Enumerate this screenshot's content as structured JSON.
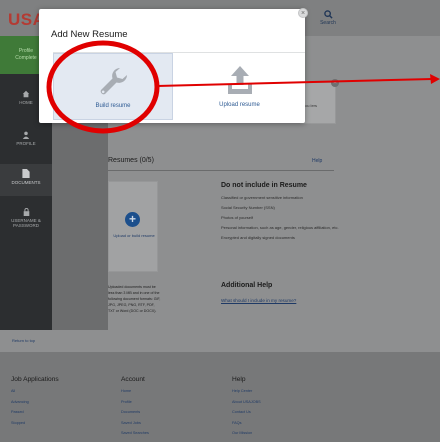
{
  "header": {
    "logo": "USAJ",
    "search_label": "Search"
  },
  "nav": {
    "profile_complete_line1": "Profile",
    "profile_complete_line2": "Complete",
    "home": "HOME",
    "profile": "PROFILE",
    "documents": "DOCUMENTS",
    "passwords_line1": "USERNAME &",
    "passwords_line2": "PASSWORD"
  },
  "partial_card_text": "ocu lers",
  "resumes": {
    "title": "Resumes (0/5)",
    "help": "Help",
    "upload_card_label": "Upload or build resume",
    "upload_note": "Uploaded documents must be less than 3 MB and in one of the following document formats: GIF, JPG, JPEG, PNG, RTF, PDF, TXT or Word (DOC or DOCX)."
  },
  "do_not_include": {
    "title": "Do not include in Resume",
    "items": [
      "Classified or government sensitive information",
      "Social Security Number (SSN)",
      "Photos of yourself",
      "Personal information, such as age, gender, religious affiliation, etc.",
      "Encrypted and digitally signed documents"
    ]
  },
  "additional_help": {
    "title": "Additional Help",
    "link": "What should I include in my resume?"
  },
  "return_to_top": "Return to top",
  "footer": {
    "col1": {
      "title": "Job Applications",
      "links": [
        "All",
        "Advancing",
        "Passed",
        "Stopped"
      ]
    },
    "col2": {
      "title": "Account",
      "links": [
        "Home",
        "Profile",
        "Documents",
        "Saved Jobs",
        "Saved Searches"
      ]
    },
    "col3": {
      "title": "Help",
      "links": [
        "Help Center",
        "About USAJOBS",
        "Contact Us",
        "FAQs",
        "Our Mission"
      ]
    }
  },
  "modal": {
    "title": "Add New Resume",
    "close": "×",
    "build_label": "Build resume",
    "upload_label": "Upload resume"
  },
  "colors": {
    "highlight_circle": "#e00000",
    "annotation_arrow": "#e00000",
    "accent_blue": "#2d5a93"
  },
  "icons": [
    "search-icon",
    "home-icon",
    "profile-icon",
    "documents-icon",
    "lock-icon",
    "wrench-icon",
    "upload-icon",
    "plus-icon",
    "close-icon"
  ]
}
